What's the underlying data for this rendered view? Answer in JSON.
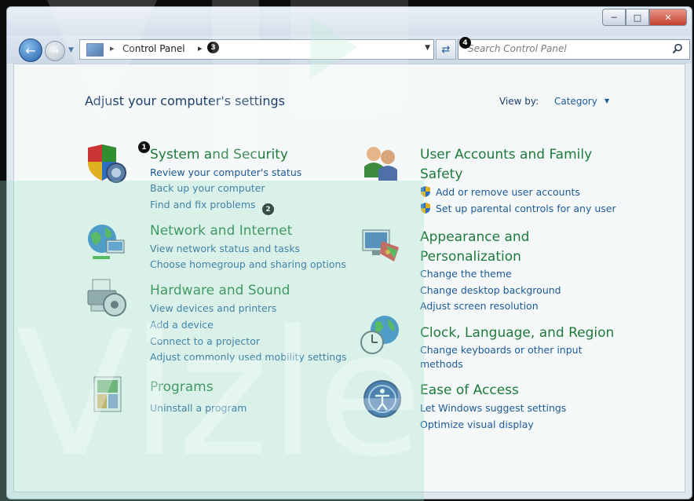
{
  "window": {
    "title_buttons": {
      "minimize_icon": "minimize-icon",
      "maximize_icon": "maximize-icon",
      "close_icon": "close-icon"
    }
  },
  "nav": {
    "address_crumb": "Control Panel",
    "search_placeholder": "Search Control Panel"
  },
  "header": {
    "heading": "Adjust your computer's settings",
    "view_by_label": "View by:",
    "view_by_value": "Category"
  },
  "categories": {
    "system": {
      "title": "System and Security",
      "links": [
        "Review your computer's status",
        "Back up your computer",
        "Find and fix problems"
      ]
    },
    "network": {
      "title": "Network and Internet",
      "links": [
        "View network status and tasks",
        "Choose homegroup and sharing options"
      ]
    },
    "hardware": {
      "title": "Hardware and Sound",
      "links": [
        "View devices and printers",
        "Add a device",
        "Connect to a projector",
        "Adjust commonly used mobility settings"
      ]
    },
    "programs": {
      "title": "Programs",
      "links": [
        "Uninstall a program"
      ]
    },
    "users": {
      "title_line1": "User Accounts and Family",
      "title_line2": "Safety",
      "links": [
        "Add or remove user accounts",
        "Set up parental controls for any user"
      ]
    },
    "appearance": {
      "title_line1": "Appearance and",
      "title_line2": "Personalization",
      "links": [
        "Change the theme",
        "Change desktop background",
        "Adjust screen resolution"
      ]
    },
    "clock": {
      "title": "Clock, Language, and Region",
      "links": [
        "Change keyboards or other input",
        "methods"
      ]
    },
    "ease": {
      "title": "Ease of Access",
      "links": [
        "Let Windows suggest settings",
        "Optimize visual display"
      ]
    }
  },
  "markers": [
    "1",
    "2",
    "3",
    "4"
  ],
  "watermark": "Vizle",
  "colors": {
    "category_title": "#1c7a3a",
    "link": "#1c5a96",
    "heading": "#1e3e6a"
  }
}
